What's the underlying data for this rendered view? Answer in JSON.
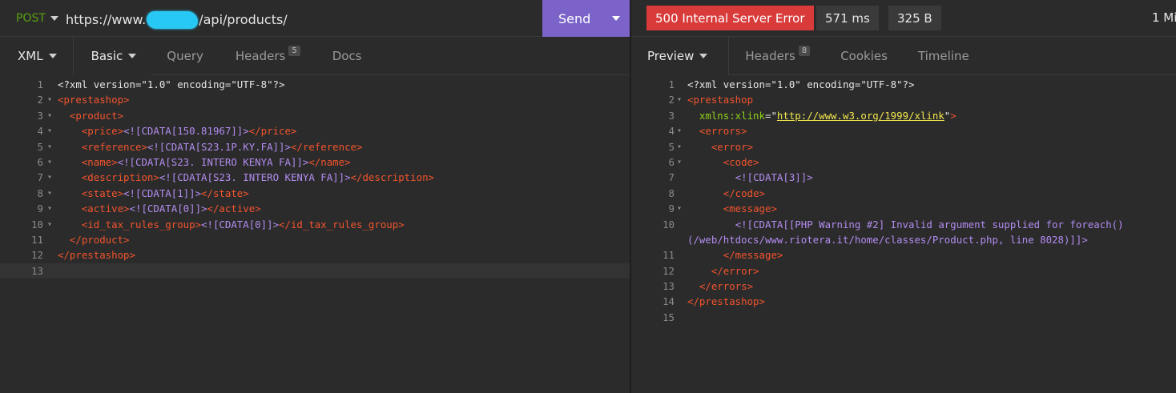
{
  "request": {
    "method": "POST",
    "url_prefix": "https://www.",
    "url_suffix": "/api/products/",
    "send_label": "Send"
  },
  "request_tabs": [
    {
      "label": "XML",
      "active": true
    },
    {
      "label": "Basic"
    },
    {
      "label": "Query"
    },
    {
      "label": "Headers",
      "badge": "5"
    },
    {
      "label": "Docs"
    }
  ],
  "request_body": [
    {
      "n": "1",
      "fold": "",
      "segs": [
        [
          "plain",
          "<?xml version=\"1.0\" encoding=\"UTF-8\"?>"
        ]
      ]
    },
    {
      "n": "2",
      "fold": "▾",
      "segs": [
        [
          "tag",
          "<prestashop>"
        ]
      ]
    },
    {
      "n": "3",
      "fold": "▾",
      "segs": [
        [
          "plain",
          "  "
        ],
        [
          "tag",
          "<product>"
        ]
      ]
    },
    {
      "n": "4",
      "fold": "▾",
      "segs": [
        [
          "plain",
          "    "
        ],
        [
          "tag",
          "<price>"
        ],
        [
          "cdata",
          "<![CDATA[150.81967]]>"
        ],
        [
          "tag",
          "</price>"
        ]
      ]
    },
    {
      "n": "5",
      "fold": "▾",
      "segs": [
        [
          "plain",
          "    "
        ],
        [
          "tag",
          "<reference>"
        ],
        [
          "cdata",
          "<![CDATA[S23.1P.KY.FA]]>"
        ],
        [
          "tag",
          "</reference>"
        ]
      ]
    },
    {
      "n": "6",
      "fold": "▾",
      "segs": [
        [
          "plain",
          "    "
        ],
        [
          "tag",
          "<name>"
        ],
        [
          "cdata",
          "<![CDATA[S23. INTERO KENYA FA]]>"
        ],
        [
          "tag",
          "</name>"
        ]
      ]
    },
    {
      "n": "7",
      "fold": "▾",
      "segs": [
        [
          "plain",
          "    "
        ],
        [
          "tag",
          "<description>"
        ],
        [
          "cdata",
          "<![CDATA[S23. INTERO KENYA FA]]>"
        ],
        [
          "tag",
          "</description>"
        ]
      ]
    },
    {
      "n": "8",
      "fold": "▾",
      "segs": [
        [
          "plain",
          "    "
        ],
        [
          "tag",
          "<state>"
        ],
        [
          "cdata",
          "<![CDATA[1]]>"
        ],
        [
          "tag",
          "</state>"
        ]
      ]
    },
    {
      "n": "9",
      "fold": "▾",
      "segs": [
        [
          "plain",
          "    "
        ],
        [
          "tag",
          "<active>"
        ],
        [
          "cdata",
          "<![CDATA[0]]>"
        ],
        [
          "tag",
          "</active>"
        ]
      ]
    },
    {
      "n": "10",
      "fold": "▾",
      "segs": [
        [
          "plain",
          "    "
        ],
        [
          "tag",
          "<id_tax_rules_group>"
        ],
        [
          "cdata",
          "<![CDATA[0]]>"
        ],
        [
          "tag",
          "</id_tax_rules_group>"
        ]
      ]
    },
    {
      "n": "11",
      "fold": "",
      "segs": [
        [
          "plain",
          "  "
        ],
        [
          "tag",
          "</product>"
        ]
      ]
    },
    {
      "n": "12",
      "fold": "",
      "segs": [
        [
          "tag",
          "</prestashop>"
        ]
      ]
    },
    {
      "n": "13",
      "fold": "",
      "segs": [],
      "highlight": true
    }
  ],
  "response": {
    "status": "500 Internal Server Error",
    "time": "571 ms",
    "size": "325 B",
    "age": "1 Mi"
  },
  "response_tabs": [
    {
      "label": "Preview",
      "active": true
    },
    {
      "label": "Headers",
      "badge": "8"
    },
    {
      "label": "Cookies"
    },
    {
      "label": "Timeline"
    }
  ],
  "response_body": [
    {
      "n": "1",
      "fold": "",
      "segs": [
        [
          "plain",
          "<?xml version=\"1.0\" encoding=\"UTF-8\"?>"
        ]
      ]
    },
    {
      "n": "2",
      "fold": "▾",
      "segs": [
        [
          "tag",
          "<prestashop"
        ]
      ]
    },
    {
      "n": "3",
      "fold": "",
      "segs": [
        [
          "plain",
          "  "
        ],
        [
          "attr",
          "xmlns:xlink"
        ],
        [
          "plain",
          "="
        ],
        [
          "plain",
          "\""
        ],
        [
          "str",
          "http://www.w3.org/1999/xlink"
        ],
        [
          "plain",
          "\""
        ],
        [
          "tag",
          ">"
        ]
      ]
    },
    {
      "n": "4",
      "fold": "▾",
      "segs": [
        [
          "plain",
          "  "
        ],
        [
          "tag",
          "<errors>"
        ]
      ]
    },
    {
      "n": "5",
      "fold": "▾",
      "segs": [
        [
          "plain",
          "    "
        ],
        [
          "tag",
          "<error>"
        ]
      ]
    },
    {
      "n": "6",
      "fold": "▾",
      "segs": [
        [
          "plain",
          "      "
        ],
        [
          "tag",
          "<code>"
        ]
      ]
    },
    {
      "n": "7",
      "fold": "",
      "segs": [
        [
          "plain",
          "        "
        ],
        [
          "cdata",
          "<![CDATA[3]]>"
        ]
      ]
    },
    {
      "n": "8",
      "fold": "",
      "segs": [
        [
          "plain",
          "      "
        ],
        [
          "tag",
          "</code>"
        ]
      ]
    },
    {
      "n": "9",
      "fold": "▾",
      "segs": [
        [
          "plain",
          "      "
        ],
        [
          "tag",
          "<message>"
        ]
      ]
    },
    {
      "n": "10",
      "fold": "",
      "segs": [
        [
          "plain",
          "        "
        ],
        [
          "cdata",
          "<![CDATA[[PHP Warning #2] Invalid argument supplied for foreach()"
        ]
      ]
    },
    {
      "n": "",
      "fold": "",
      "segs": [
        [
          "cdata",
          "(/web/htdocs/www.riotera.it/home/classes/Product.php, line 8028)]]>"
        ]
      ]
    },
    {
      "n": "11",
      "fold": "",
      "segs": [
        [
          "plain",
          "      "
        ],
        [
          "tag",
          "</message>"
        ]
      ]
    },
    {
      "n": "12",
      "fold": "",
      "segs": [
        [
          "plain",
          "    "
        ],
        [
          "tag",
          "</error>"
        ]
      ]
    },
    {
      "n": "13",
      "fold": "",
      "segs": [
        [
          "plain",
          "  "
        ],
        [
          "tag",
          "</errors>"
        ]
      ]
    },
    {
      "n": "14",
      "fold": "",
      "segs": [
        [
          "tag",
          "</prestashop>"
        ]
      ]
    },
    {
      "n": "15",
      "fold": "",
      "segs": []
    }
  ]
}
